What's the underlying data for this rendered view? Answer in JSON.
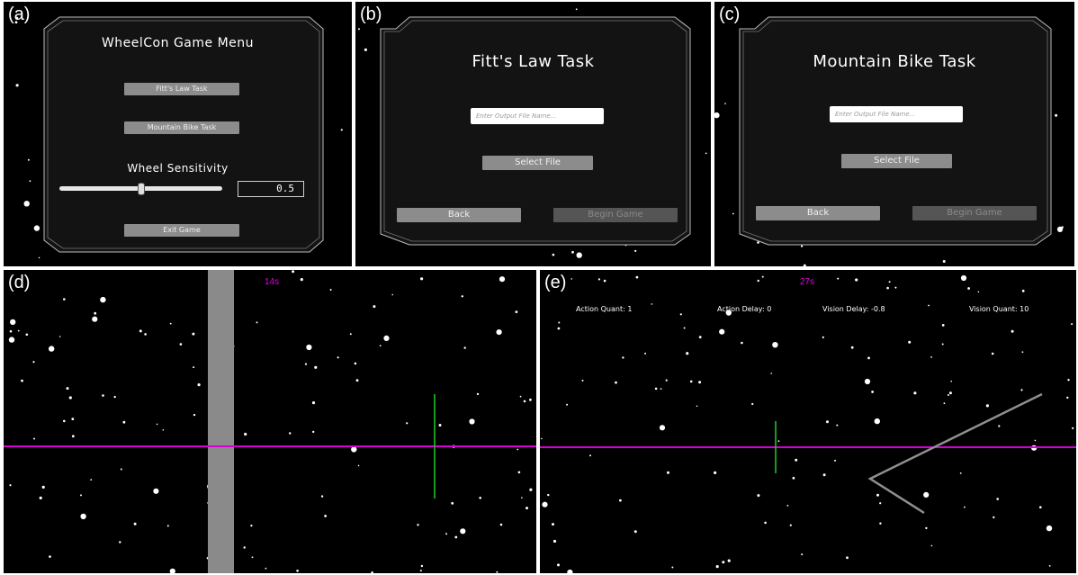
{
  "panels": {
    "a": {
      "label": "(a)",
      "title": "WheelCon Game Menu",
      "fitts_button": "Fitt's Law Task",
      "bike_button": "Mountain Bike Task",
      "sensitivity_label": "Wheel Sensitivity",
      "sensitivity_value": "0.5",
      "sensitivity_fraction": 0.5,
      "exit_button": "Exit Game"
    },
    "b": {
      "label": "(b)",
      "title": "Fitt's Law Task",
      "file_placeholder": "Enter Output File Name...",
      "select_file_button": "Select File",
      "back_button": "Back",
      "begin_button": "Begin Game"
    },
    "c": {
      "label": "(c)",
      "title": "Mountain Bike Task",
      "file_placeholder": "Enter Output File Name...",
      "select_file_button": "Select File",
      "back_button": "Back",
      "begin_button": "Begin Game"
    },
    "d": {
      "label": "(d)",
      "timer": "14s"
    },
    "e": {
      "label": "(e)",
      "timer": "27s",
      "action_quant": "Action Quant: 1",
      "action_delay": "Action Delay: 0",
      "vision_delay": "Vision Delay: -0.8",
      "vision_quant": "Vision Quant: 10"
    }
  },
  "colors": {
    "background": "#000000",
    "magenta_line": "#d400d4",
    "green_target": "#22cc22",
    "gray_obstacle": "#8a8a8a",
    "button": "#8c8c8c",
    "button_disabled": "#555555"
  }
}
